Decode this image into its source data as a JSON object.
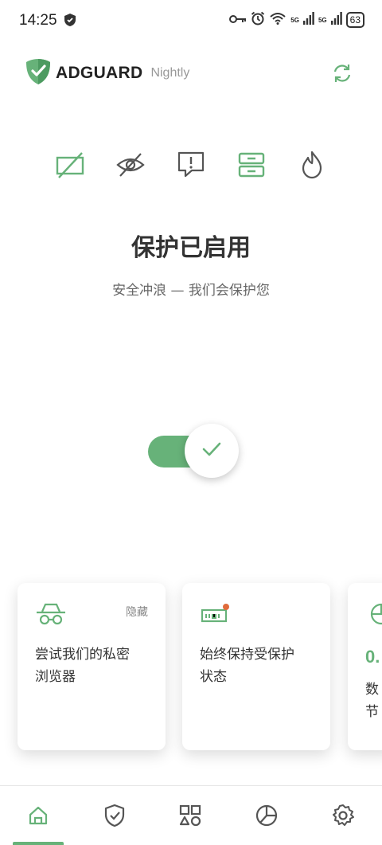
{
  "status_bar": {
    "time": "14:25",
    "battery": "63",
    "signal1": "5G",
    "signal2": "5G"
  },
  "header": {
    "brand": "ADGUARD",
    "channel": "Nightly"
  },
  "main": {
    "title": "保护已启用",
    "subtitle": "安全冲浪 — 我们会保护您",
    "protection_enabled": true
  },
  "cards": [
    {
      "label": "尝试我们的私密\n浏览器",
      "action": "隐藏",
      "icon": "incognito-icon"
    },
    {
      "label": "始终保持受保护\n状态",
      "icon": "battery-icon"
    },
    {
      "value": "0.",
      "label": "数\n节",
      "icon": "pie-icon"
    }
  ],
  "nav": [
    "home-icon",
    "shield-icon",
    "apps-icon",
    "stats-icon",
    "settings-icon"
  ],
  "colors": {
    "accent": "#67b279",
    "text": "#333333",
    "muted": "#999999"
  }
}
